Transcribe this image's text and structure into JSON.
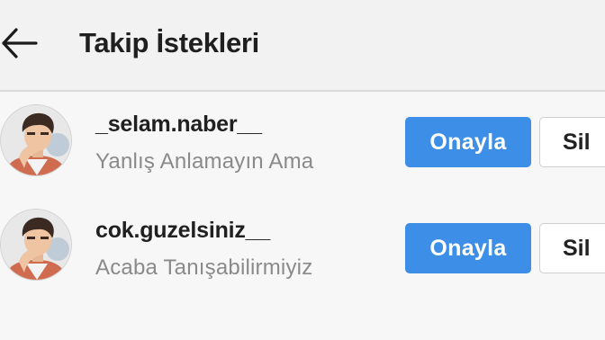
{
  "header": {
    "title": "Takip İstekleri",
    "back_icon": "arrow-left-icon"
  },
  "requests": [
    {
      "username": "_selam.naber__",
      "subtext": "Yanlış Anlamayın Ama",
      "confirm_label": "Onayla",
      "delete_label": "Sil"
    },
    {
      "username": "cok.guzelsiniz__",
      "subtext": "Acaba Tanışabilirmiyiz",
      "confirm_label": "Onayla",
      "delete_label": "Sil"
    }
  ],
  "colors": {
    "confirm_button": "#3d8ee6",
    "delete_button": "#ffffff",
    "username_text": "#202020",
    "subtext": "#8a8a8a"
  }
}
